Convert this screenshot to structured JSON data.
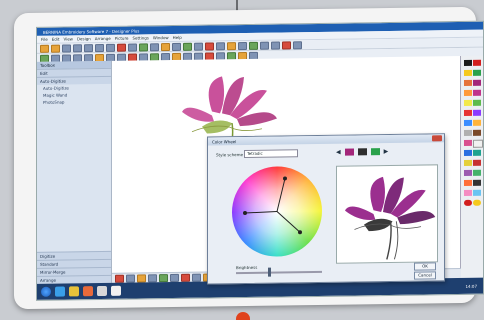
{
  "window": {
    "title": "BERNINA Embroidery Software 7 - Designer Plus"
  },
  "menubar": {
    "items": [
      "File",
      "Edit",
      "View",
      "Design",
      "Arrange",
      "Picture",
      "Settings",
      "Window",
      "Help"
    ]
  },
  "left_panel": {
    "header": "Toolbox",
    "sections": [
      {
        "label": "Edit"
      },
      {
        "label": "Auto-Digitize"
      }
    ],
    "items": [
      {
        "label": "Auto-Digitize"
      },
      {
        "label": "Magic Wand"
      },
      {
        "label": "PhotoSnap"
      }
    ],
    "bottom_sections": [
      {
        "label": "Digitize"
      },
      {
        "label": "Standard"
      },
      {
        "label": "Mirror-Merge"
      },
      {
        "label": "Arrange"
      }
    ]
  },
  "dialog": {
    "title": "Color Wheel",
    "style_label": "Style scheme",
    "style_value": "Tetradic",
    "slider_label": "Brightness",
    "buttons": [
      "OK",
      "Cancel"
    ]
  },
  "taskbar": {
    "tray_time": "14:07"
  },
  "colors": {
    "accent": "#1e5fb3",
    "flower": "#c0338a",
    "taskbar": "#1e3f6f",
    "power_led": "#e0421c"
  },
  "icons": [
    "windows-start-icon",
    "ie-icon",
    "folder-icon",
    "media-icon",
    "bernina-icon",
    "close-icon",
    "left-arrow-icon",
    "right-arrow-icon"
  ]
}
